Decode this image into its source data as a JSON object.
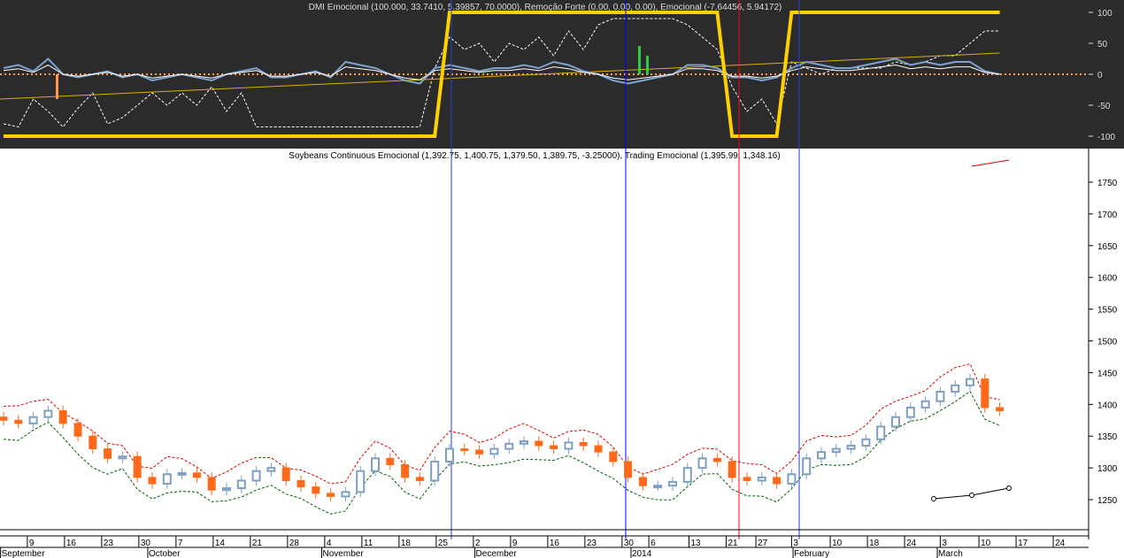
{
  "top_panel": {
    "title": "DMI Emocional (100.000, 33.7410, 5.39857, 70.0000), Remoção Forte (0.00, 0.00, 0.00), Emocional (-7.64456, 5.94172)",
    "yticks": [
      100,
      50,
      0,
      -50,
      -100
    ]
  },
  "price_panel": {
    "title": "Soybeans Continuous Emocional (1,392.75, 1,400.75, 1,379.50, 1,389.75, -3.25000), Trading Emocional (1,395.99, 1,348.16)",
    "yticks": [
      1250,
      1300,
      1350,
      1400,
      1450,
      1500,
      1550,
      1600,
      1650,
      1700,
      1750
    ]
  },
  "xaxis": {
    "days": [
      {
        "label": "9",
        "i": 1.6
      },
      {
        "label": "16",
        "i": 4.1
      },
      {
        "label": "23",
        "i": 6.6
      },
      {
        "label": "30",
        "i": 9.1
      },
      {
        "label": "7",
        "i": 11.6
      },
      {
        "label": "14",
        "i": 14.1
      },
      {
        "label": "21",
        "i": 16.6
      },
      {
        "label": "28",
        "i": 19.1
      },
      {
        "label": "4",
        "i": 21.6
      },
      {
        "label": "11",
        "i": 24.1
      },
      {
        "label": "18",
        "i": 26.6
      },
      {
        "label": "25",
        "i": 29.1
      },
      {
        "label": "2",
        "i": 31.6
      },
      {
        "label": "9",
        "i": 34.1
      },
      {
        "label": "16",
        "i": 36.6
      },
      {
        "label": "23",
        "i": 39.1
      },
      {
        "label": "30",
        "i": 41.6
      },
      {
        "label": "6",
        "i": 43.4
      },
      {
        "label": "13",
        "i": 46.1
      },
      {
        "label": "21",
        "i": 48.6
      },
      {
        "label": "27",
        "i": 50.6
      },
      {
        "label": "3",
        "i": 53.0
      },
      {
        "label": "10",
        "i": 55.6
      },
      {
        "label": "18",
        "i": 58.1
      },
      {
        "label": "24",
        "i": 60.6
      },
      {
        "label": "3",
        "i": 63.0
      },
      {
        "label": "10",
        "i": 65.6
      },
      {
        "label": "17",
        "i": 68.1
      },
      {
        "label": "24",
        "i": 70.6
      }
    ],
    "months": [
      {
        "label": "September",
        "i": -0.2
      },
      {
        "label": "October",
        "i": 9.7
      },
      {
        "label": "November",
        "i": 21.4
      },
      {
        "label": "December",
        "i": 31.7
      },
      {
        "label": "2014",
        "i": 42.2
      },
      {
        "label": "February",
        "i": 53.1
      },
      {
        "label": "March",
        "i": 62.8
      }
    ]
  },
  "colors": {
    "bg_top": "#2b2b2b",
    "up": "#7f9fc0",
    "down": "#ff6a1a",
    "yellow": "#ffd000",
    "blue": "#7fa3d0"
  },
  "chart_data": {
    "type": "line",
    "closes": [
      1375,
      1370,
      1380,
      1390,
      1370,
      1350,
      1330,
      1315,
      1318,
      1285,
      1275,
      1290,
      1292,
      1285,
      1265,
      1268,
      1280,
      1295,
      1300,
      1280,
      1270,
      1260,
      1255,
      1262,
      1295,
      1315,
      1305,
      1285,
      1280,
      1310,
      1330,
      1328,
      1322,
      1330,
      1338,
      1342,
      1335,
      1330,
      1340,
      1335,
      1325,
      1310,
      1285,
      1272,
      1272,
      1278,
      1300,
      1315,
      1310,
      1285,
      1280,
      1285,
      1275,
      1290,
      1315,
      1325,
      1330,
      1335,
      1345,
      1365,
      1380,
      1395,
      1405,
      1420,
      1430,
      1440,
      1395,
      1390
    ],
    "dmi": [
      -100,
      -100,
      -100,
      -100,
      -100,
      -100,
      -100,
      -100,
      -100,
      -100,
      -100,
      -100,
      -100,
      -100,
      -100,
      -100,
      -100,
      -100,
      -100,
      -100,
      -100,
      -100,
      -100,
      -100,
      -100,
      -100,
      -100,
      -100,
      -100,
      -100,
      100,
      100,
      100,
      100,
      100,
      100,
      100,
      100,
      100,
      100,
      100,
      100,
      100,
      100,
      100,
      100,
      100,
      100,
      100,
      -100,
      -100,
      -100,
      -100,
      100,
      100,
      100,
      100,
      100,
      100,
      100,
      100,
      100,
      100,
      100,
      100,
      100,
      100,
      100
    ],
    "oscillator": [
      -80,
      -85,
      -40,
      -60,
      -85,
      -55,
      -30,
      -80,
      -70,
      -50,
      -30,
      -50,
      -30,
      -50,
      -20,
      -60,
      -30,
      -85,
      -85,
      -85,
      -85,
      -85,
      -85,
      -85,
      -85,
      -85,
      -85,
      -85,
      -85,
      10,
      60,
      40,
      50,
      20,
      50,
      40,
      60,
      30,
      70,
      40,
      80,
      90,
      90,
      90,
      90,
      90,
      80,
      60,
      40,
      -20,
      -60,
      -40,
      -80,
      20,
      10,
      0,
      10,
      10,
      10,
      10,
      20,
      15,
      20,
      30,
      30,
      50,
      70,
      70
    ],
    "emocional": [
      10,
      15,
      5,
      25,
      0,
      -5,
      0,
      5,
      -5,
      0,
      -10,
      -5,
      0,
      -5,
      -10,
      0,
      5,
      10,
      -5,
      -5,
      0,
      5,
      -5,
      20,
      15,
      10,
      0,
      -10,
      -15,
      10,
      15,
      10,
      5,
      10,
      10,
      15,
      10,
      20,
      15,
      5,
      0,
      -10,
      -15,
      -10,
      -5,
      0,
      15,
      15,
      10,
      -5,
      -5,
      -10,
      -5,
      10,
      20,
      15,
      10,
      10,
      15,
      20,
      25,
      15,
      20,
      15,
      20,
      20,
      5,
      0
    ]
  }
}
